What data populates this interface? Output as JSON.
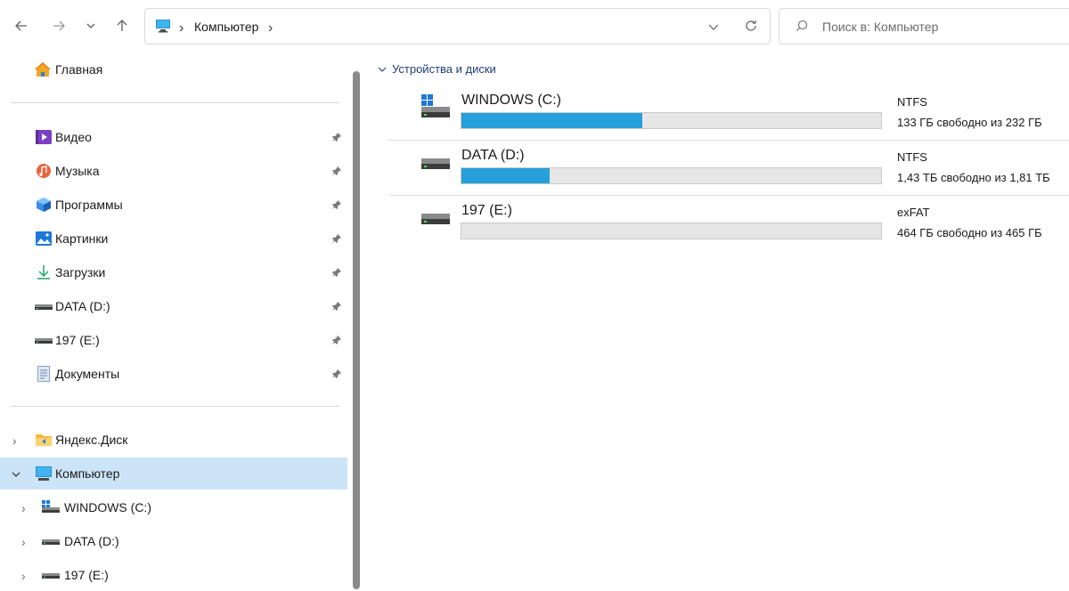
{
  "address": {
    "crumb": "Компьютер",
    "search_placeholder": "Поиск в: Компьютер"
  },
  "sidebar": {
    "home": "Главная",
    "pinned": [
      {
        "label": "Видео",
        "icon": "video-icon"
      },
      {
        "label": "Музыка",
        "icon": "music-icon"
      },
      {
        "label": "Программы",
        "icon": "programs-icon"
      },
      {
        "label": "Картинки",
        "icon": "pictures-icon"
      },
      {
        "label": "Загрузки",
        "icon": "downloads-icon"
      },
      {
        "label": "DATA (D:)",
        "icon": "drive-icon"
      },
      {
        "label": "197 (E:)",
        "icon": "drive-icon"
      },
      {
        "label": "Документы",
        "icon": "documents-icon"
      }
    ],
    "tree": [
      {
        "label": "Яндекс.Диск",
        "icon": "folder-icon"
      },
      {
        "label": "Компьютер",
        "icon": "computer-icon",
        "selected": true
      },
      {
        "label": "WINDOWS (C:)",
        "icon": "windows-drive-icon"
      },
      {
        "label": "DATA (D:)",
        "icon": "drive-icon"
      },
      {
        "label": "197 (E:)",
        "icon": "drive-icon"
      }
    ]
  },
  "main": {
    "section_title": "Устройства и диски",
    "drives": [
      {
        "name": "WINDOWS (C:)",
        "fs": "NTFS",
        "free_text": "133 ГБ свободно из 232 ГБ",
        "used_fraction": 0.43
      },
      {
        "name": "DATA (D:)",
        "fs": "NTFS",
        "free_text": "1,43 ТБ свободно из 1,81 ТБ",
        "used_fraction": 0.21
      },
      {
        "name": "197 (E:)",
        "fs": "exFAT",
        "free_text": "464 ГБ свободно из 465 ГБ",
        "used_fraction": 0.0
      }
    ]
  },
  "colors": {
    "accent": "#26a0da",
    "selection": "#cce4f7"
  }
}
